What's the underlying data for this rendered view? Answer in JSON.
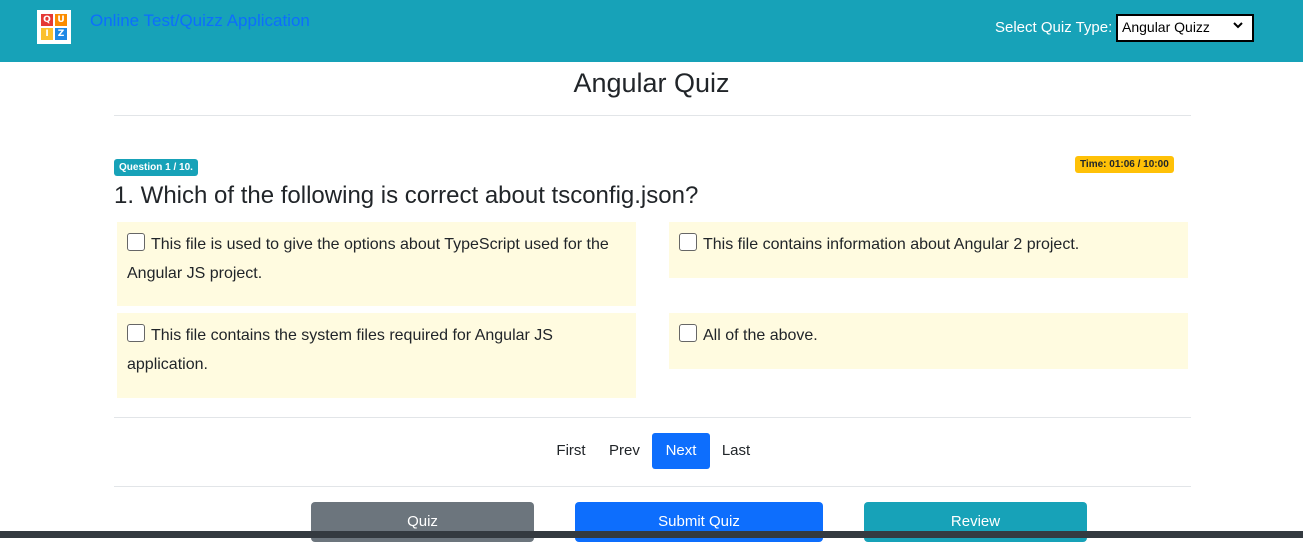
{
  "header": {
    "logo_letters": [
      "Q",
      "U",
      "I",
      "Z"
    ],
    "app_title": "Online Test/Quizz Application",
    "quiz_type_label": "Select Quiz Type:",
    "quiz_type_selected": "Angular Quizz"
  },
  "quiz": {
    "title": "Angular Quiz",
    "question_badge": "Question 1 / 10.",
    "time_badge": "Time: 01:06 / 10:00",
    "question": "1. Which of the following is correct about tsconfig.json?",
    "options": [
      {
        "label": "This file is used to give the options about TypeScript used for the Angular JS project.",
        "checked": false
      },
      {
        "label": "This file contains information about Angular 2 project.",
        "checked": false
      },
      {
        "label": "This file contains the system files required for Angular JS application.",
        "checked": false
      },
      {
        "label": "All of the above.",
        "checked": false
      }
    ]
  },
  "pager": {
    "first": "First",
    "prev": "Prev",
    "next": "Next",
    "last": "Last"
  },
  "actions": {
    "quiz": "Quiz",
    "submit": "Submit Quiz",
    "review": "Review"
  },
  "colors": {
    "navbar": "#17a2b8",
    "primary": "#0d6efd",
    "secondary": "#6c757d",
    "warning": "#ffc107",
    "option_bg": "#fffbe0"
  }
}
